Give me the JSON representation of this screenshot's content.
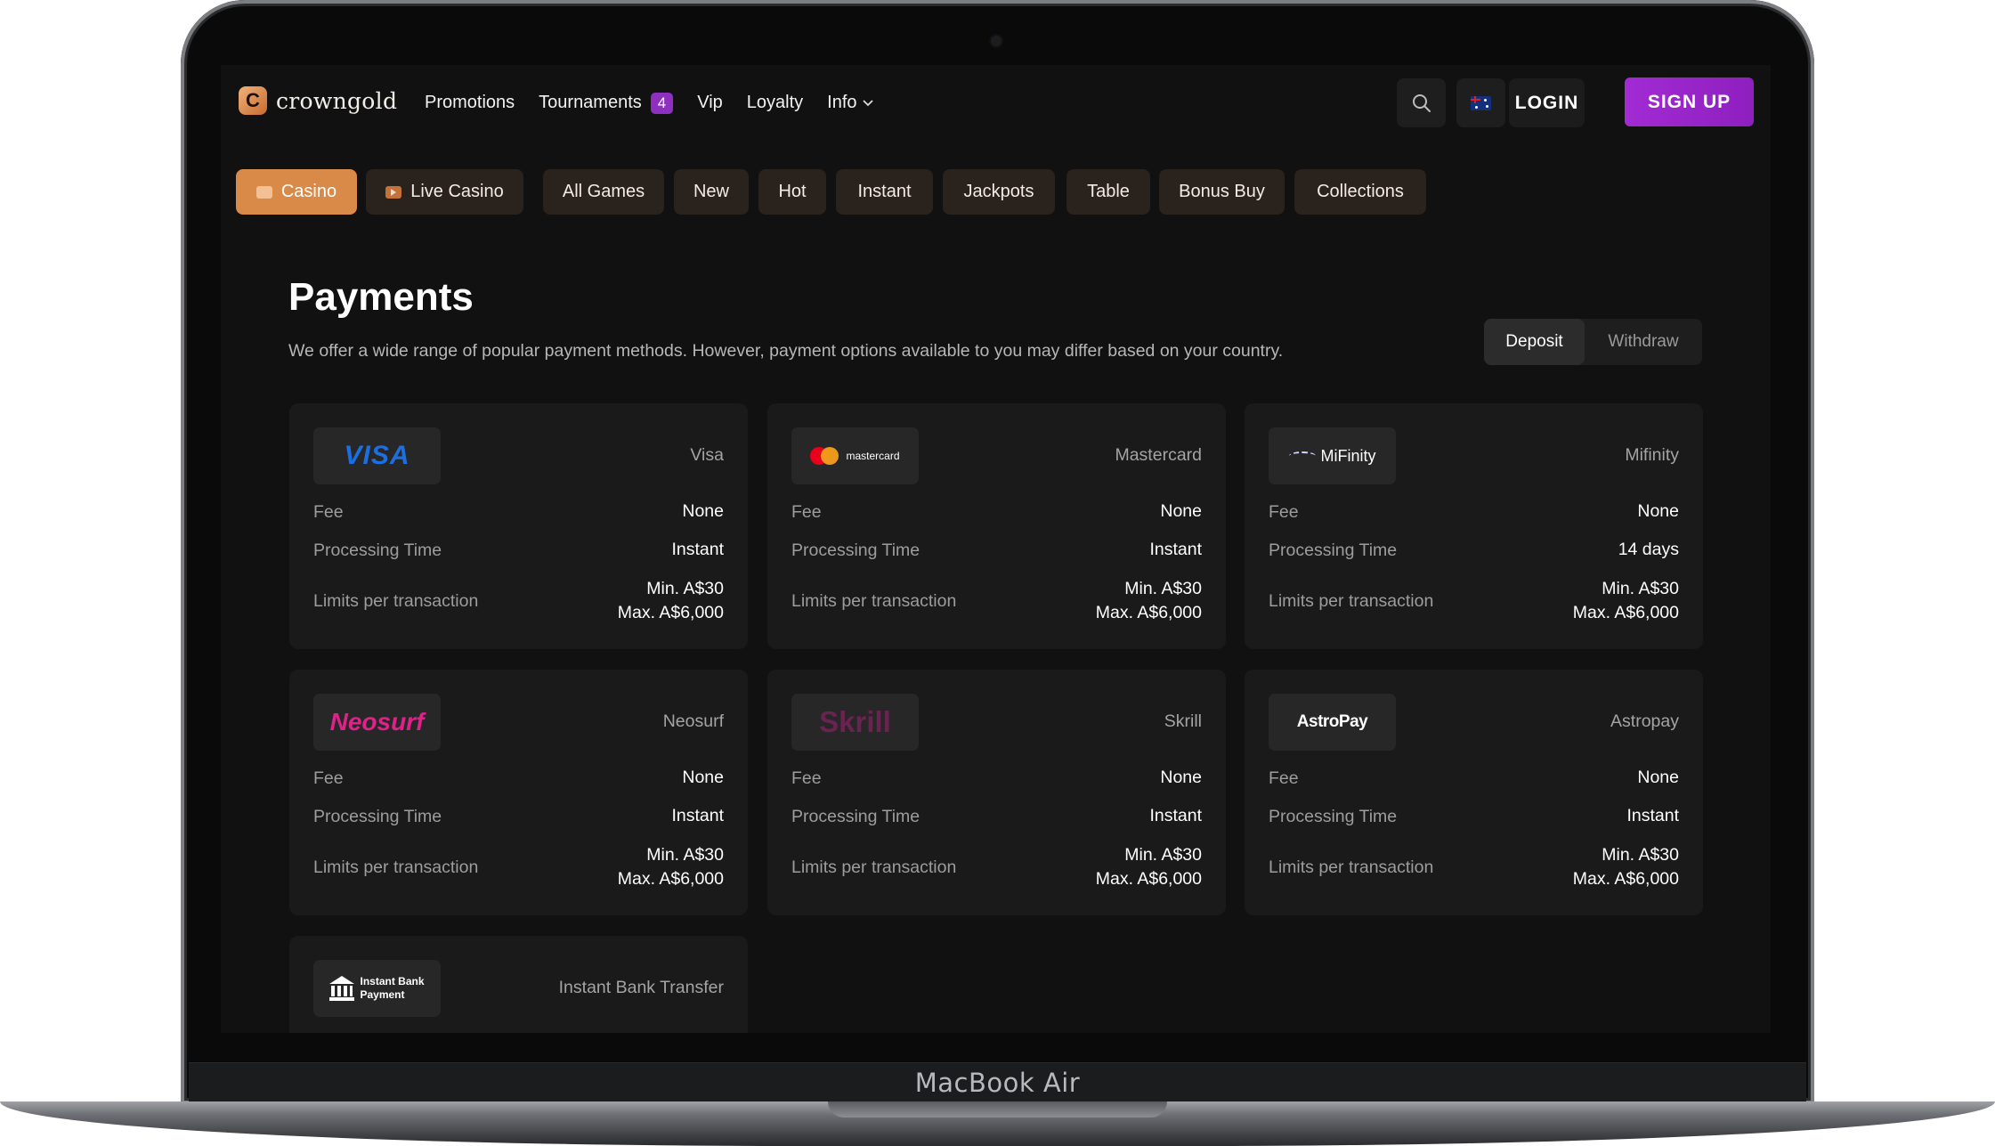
{
  "device": {
    "label": "MacBook Air"
  },
  "header": {
    "logo_text": "crowngold",
    "logo_letter": "C",
    "nav": [
      {
        "label": "Promotions"
      },
      {
        "label": "Tournaments",
        "badge": "4"
      },
      {
        "label": "Vip"
      },
      {
        "label": "Loyalty"
      },
      {
        "label": "Info",
        "icon": "chevron-down-icon"
      }
    ],
    "search_icon": "search-icon",
    "flag_icon": "australia-flag-icon",
    "login_label": "LOGIN",
    "signup_label": "SIGN UP"
  },
  "categories": [
    {
      "label": "Casino",
      "icon": "casino-icon",
      "active": true
    },
    {
      "label": "Live Casino",
      "icon": "play-icon"
    },
    {
      "label": "All Games"
    },
    {
      "label": "New"
    },
    {
      "label": "Hot"
    },
    {
      "label": "Instant"
    },
    {
      "label": "Jackpots"
    },
    {
      "label": "Table"
    },
    {
      "label": "Bonus Buy"
    },
    {
      "label": "Collections"
    }
  ],
  "page": {
    "title": "Payments",
    "subtitle": "We offer a wide range of popular payment methods. However, payment options available to you may differ based on your country.",
    "toggle": {
      "deposit": "Deposit",
      "withdraw": "Withdraw",
      "selected": "Deposit"
    }
  },
  "labels": {
    "fee": "Fee",
    "processing": "Processing Time",
    "limits": "Limits per transaction"
  },
  "methods": [
    {
      "name": "Visa",
      "logo_text": "VISA",
      "fee": "None",
      "processing": "Instant",
      "min": "Min. A$30",
      "max": "Max. A$6,000"
    },
    {
      "name": "Mastercard",
      "logo_text": "mastercard",
      "fee": "None",
      "processing": "Instant",
      "min": "Min. A$30",
      "max": "Max. A$6,000"
    },
    {
      "name": "Mifinity",
      "logo_text": "MiFinity",
      "fee": "None",
      "processing": "14 days",
      "min": "Min. A$30",
      "max": "Max. A$6,000"
    },
    {
      "name": "Neosurf",
      "logo_text": "Neosurf",
      "fee": "None",
      "processing": "Instant",
      "min": "Min. A$30",
      "max": "Max. A$6,000"
    },
    {
      "name": "Skrill",
      "logo_text": "Skrill",
      "fee": "None",
      "processing": "Instant",
      "min": "Min. A$30",
      "max": "Max. A$6,000"
    },
    {
      "name": "Astropay",
      "logo_text": "AstroPay",
      "fee": "None",
      "processing": "Instant",
      "min": "Min. A$30",
      "max": "Max. A$6,000"
    },
    {
      "name": "Instant Bank Transfer",
      "logo_line1": "Instant Bank",
      "logo_line2": "Payment"
    }
  ],
  "colors": {
    "accent_orange": "#d98a48",
    "signup_purple": "#9b27cc",
    "background": "#111111",
    "card": "#1a1a1a"
  }
}
